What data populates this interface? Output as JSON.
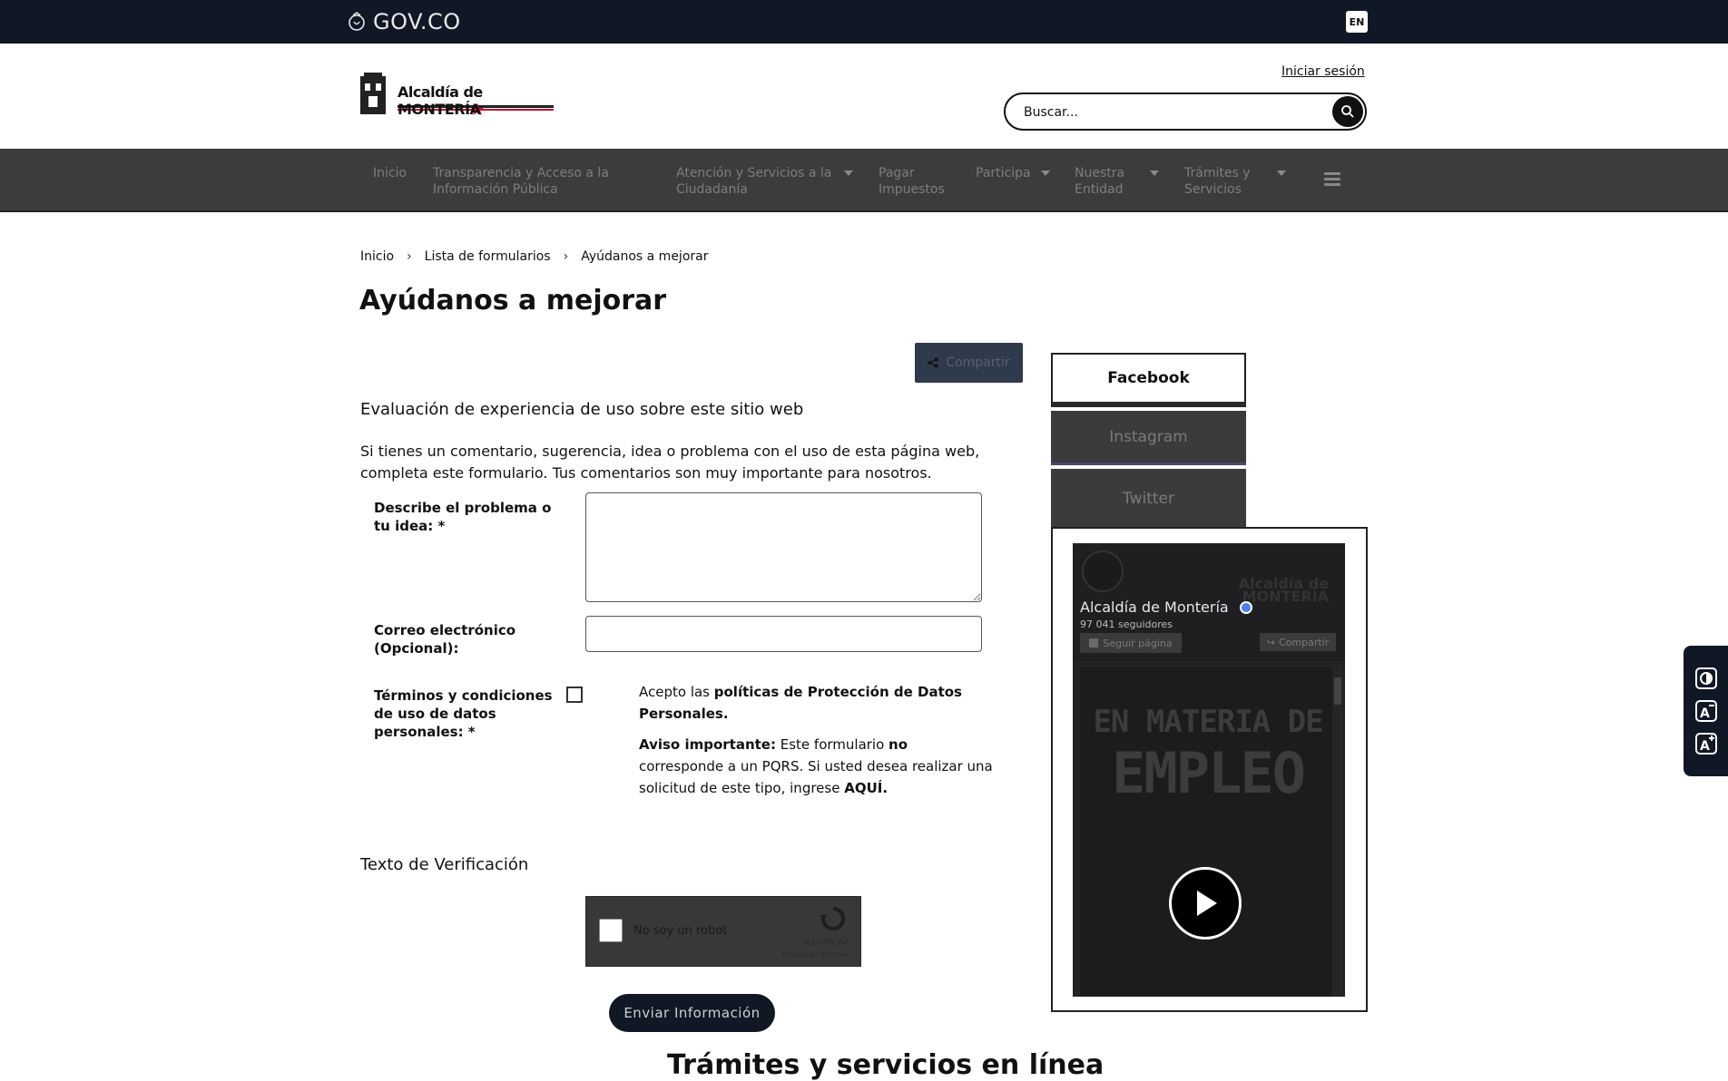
{
  "govbar": {
    "brand": "GOV.CO",
    "lang_button": "EN"
  },
  "header": {
    "logo_text": "Alcaldía de MONTERÍA",
    "login_link": "Iniciar sesión",
    "search": {
      "placeholder": "Buscar..."
    }
  },
  "nav": {
    "items": [
      {
        "label": "Inicio"
      },
      {
        "label": "Transparencia y Acceso a la Información Pública"
      },
      {
        "label": "Atención y Servicios a la Ciudadanía"
      },
      {
        "label": "Pagar Impuestos"
      },
      {
        "label": "Participa"
      },
      {
        "label": "Nuestra Entidad"
      },
      {
        "label": "Trámites y Servicios"
      }
    ]
  },
  "breadcrumb": [
    "Inicio",
    "Lista de formularios",
    "Ayúdanos a mejorar"
  ],
  "page_title": "Ayúdanos a mejorar",
  "share_label": "Compartir",
  "form": {
    "subtitle": "Evaluación de experiencia de uso sobre este sitio web",
    "intro": "Si tienes un comentario, sugerencia, idea o problema con el uso de esta página web, completa este formulario. Tus comentarios son muy importante para nosotros.",
    "desc_label": "Describe el problema o tu idea: *",
    "email_label": "Correo electrónico (Opcional):",
    "terms_label": "Términos y condiciones de uso de datos personales: *",
    "terms_pre": "Acepto las ",
    "terms_link": "políticas de Protección de Datos Personales.",
    "aviso_bold": "Aviso importante:",
    "aviso_text_1": " Este formulario ",
    "aviso_no": "no",
    "aviso_text_2": " corresponde a un PQRS. Si usted desea realizar una solicitud de este tipo, ingrese ",
    "aviso_link": "AQUÍ.",
    "verification_label": "Texto de Verificación",
    "recaptcha": {
      "label": "No soy un robot",
      "brand": "reCAPTCHA",
      "links": "Privacidad - Términos"
    },
    "submit_label": "Enviar Información"
  },
  "section_heading": "Trámites y servicios en línea",
  "social": {
    "tabs": [
      "Facebook",
      "Instagram",
      "Twitter"
    ],
    "active_tab": "Facebook",
    "fb": {
      "page_name": "Alcaldía de Montería",
      "followers": "97 041 seguidores",
      "follow_button": "Seguir página",
      "share_button": "Compartir",
      "video_line_1": "EN MATERIA DE",
      "video_line_2": "EMPLEO"
    }
  },
  "colors": {
    "topbar": "#101826",
    "nav": "#3c3c3c",
    "accent_red": "#c8102e"
  }
}
